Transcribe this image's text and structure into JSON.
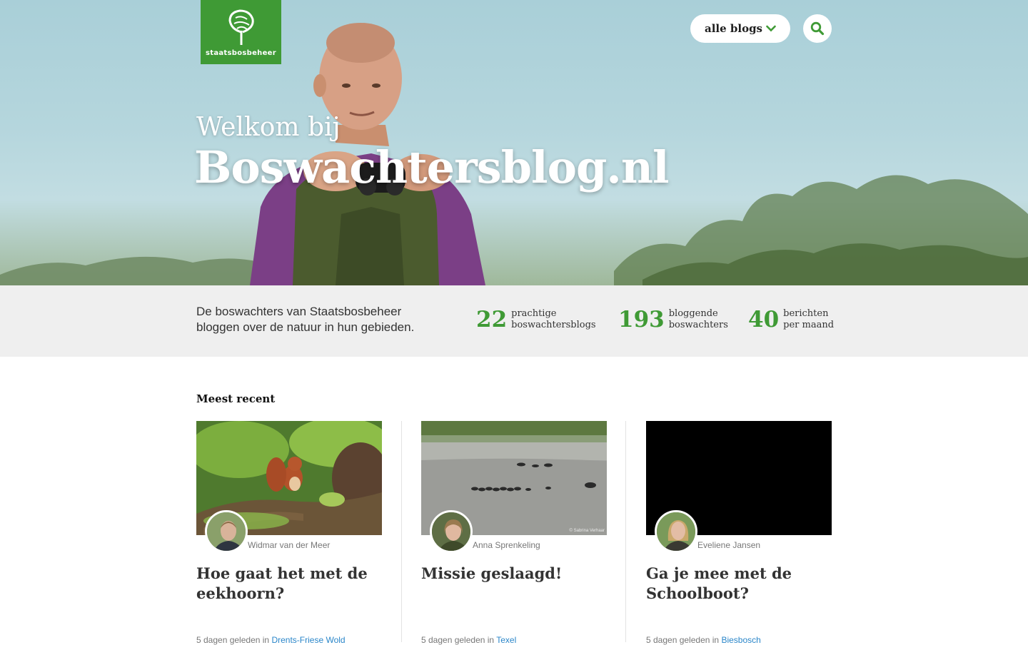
{
  "brand": {
    "logo_text": "staatsbosbeheer",
    "accent": "#3f9a35",
    "link": "#2a86c9"
  },
  "header": {
    "select_label": "alle blogs",
    "select_icon": "chevron-down-icon",
    "search_icon": "search-icon"
  },
  "hero": {
    "welcome": "Welkom bij",
    "title": "Boswachtersblog.nl"
  },
  "stats": {
    "intro": "De boswachters van Staatsbosbeheer bloggen over de natuur in hun gebieden.",
    "items": [
      {
        "number": "22",
        "line1": "prachtige",
        "line2": "boswachtersblogs"
      },
      {
        "number": "193",
        "line1": "bloggende",
        "line2": "boswachters"
      },
      {
        "number": "40",
        "line1": "berichten",
        "line2": "per maand"
      }
    ]
  },
  "recent": {
    "heading": "Meest recent",
    "posts": [
      {
        "author": "Widmar van der Meer",
        "title": "Hoe gaat het met de eekhoorn?",
        "time": "5 dagen geleden",
        "in": "in",
        "area": "Drents-Friese Wold"
      },
      {
        "author": "Anna Sprenkeling",
        "title": "Missie geslaagd!",
        "time": "5 dagen geleden",
        "in": "in",
        "area": "Texel",
        "credit": "© Sabrina Verhaar"
      },
      {
        "author": "Eveliene Jansen",
        "title": "Ga je mee met de Schoolboot?",
        "time": "5 dagen geleden",
        "in": "in",
        "area": "Biesbosch"
      }
    ]
  }
}
